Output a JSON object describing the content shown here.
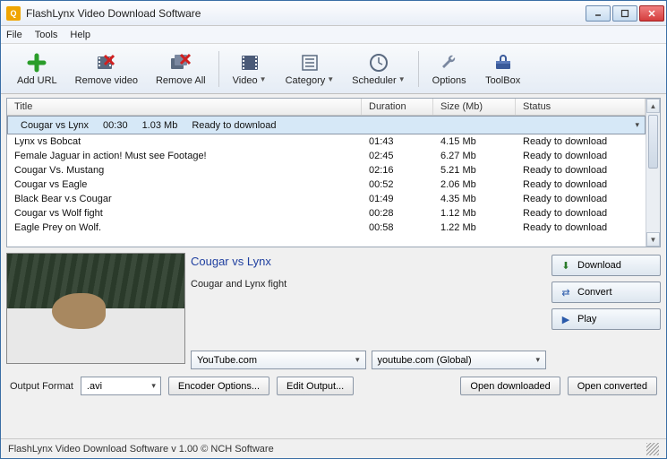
{
  "window": {
    "title": "FlashLynx Video Download Software"
  },
  "menu": {
    "file": "File",
    "tools": "Tools",
    "help": "Help"
  },
  "toolbar": {
    "add_url": "Add URL",
    "remove_video": "Remove video",
    "remove_all": "Remove All",
    "video": "Video",
    "category": "Category",
    "scheduler": "Scheduler",
    "options": "Options",
    "toolbox": "ToolBox"
  },
  "columns": {
    "title": "Title",
    "duration": "Duration",
    "size": "Size (Mb)",
    "status": "Status"
  },
  "rows": [
    {
      "title": "Cougar vs Lynx",
      "duration": "00:30",
      "size": "1.03 Mb",
      "status": "Ready to download"
    },
    {
      "title": "Lynx vs Bobcat",
      "duration": "01:43",
      "size": "4.15 Mb",
      "status": "Ready to download"
    },
    {
      "title": "Female Jaguar in action! Must see Footage!",
      "duration": "02:45",
      "size": "6.27 Mb",
      "status": "Ready to download"
    },
    {
      "title": "Cougar Vs. Mustang",
      "duration": "02:16",
      "size": "5.21 Mb",
      "status": "Ready to download"
    },
    {
      "title": "Cougar vs Eagle",
      "duration": "00:52",
      "size": "2.06 Mb",
      "status": "Ready to download"
    },
    {
      "title": "Black Bear v.s Cougar",
      "duration": "01:49",
      "size": "4.35 Mb",
      "status": "Ready to download"
    },
    {
      "title": "Cougar vs Wolf fight",
      "duration": "00:28",
      "size": "1.12 Mb",
      "status": "Ready to download"
    },
    {
      "title": "Eagle Prey on Wolf.",
      "duration": "00:58",
      "size": "1.22 Mb",
      "status": "Ready to download"
    }
  ],
  "detail": {
    "title": "Cougar vs Lynx",
    "desc": "Cougar and Lynx fight",
    "source": "YouTube.com",
    "server": "youtube.com (Global)"
  },
  "actions": {
    "download": "Download",
    "convert": "Convert",
    "play": "Play"
  },
  "bottom": {
    "output_format_label": "Output Format",
    "output_format_value": ".avi",
    "encoder_options": "Encoder Options...",
    "edit_output": "Edit Output...",
    "open_downloaded": "Open downloaded",
    "open_converted": "Open converted"
  },
  "status": "FlashLynx Video Download Software v 1.00 © NCH Software"
}
